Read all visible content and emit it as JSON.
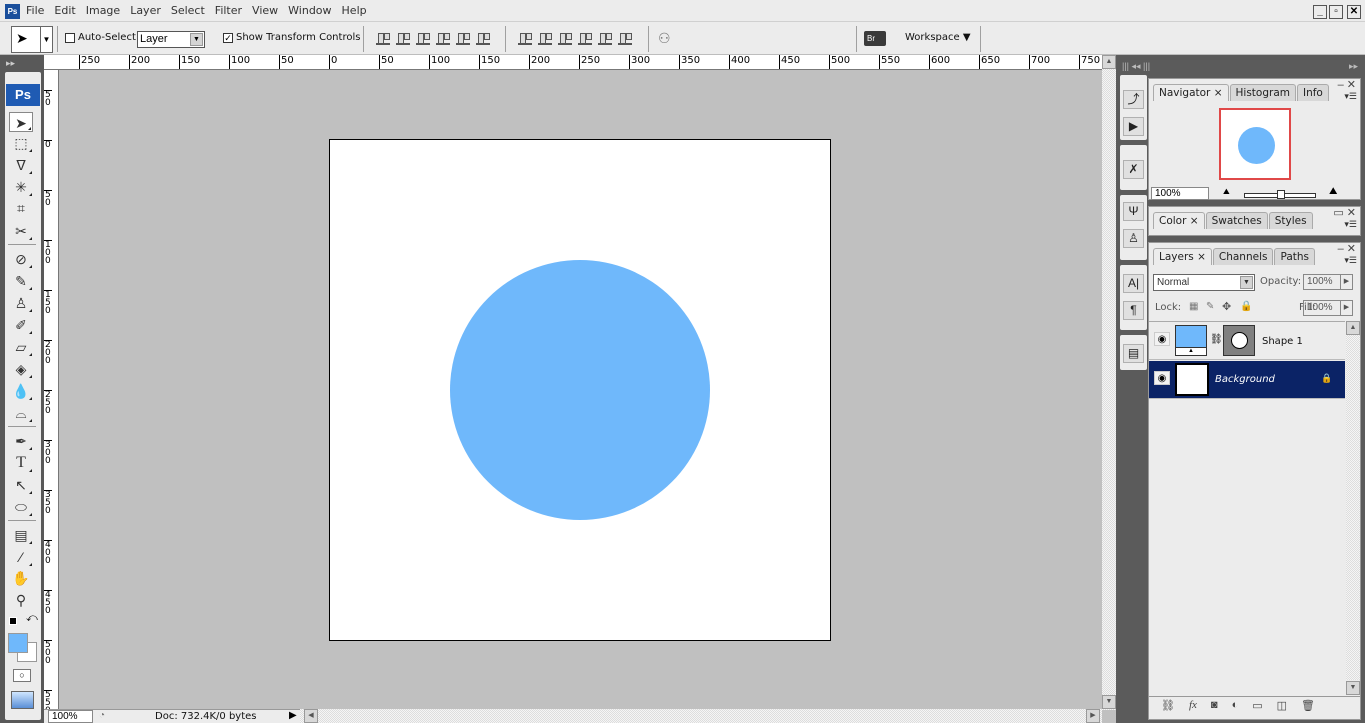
{
  "app": {
    "logo": "Ps",
    "window_controls": {
      "minimize": "_",
      "restore": "▫",
      "close": "✕"
    }
  },
  "menu": [
    "File",
    "Edit",
    "Image",
    "Layer",
    "Select",
    "Filter",
    "View",
    "Window",
    "Help"
  ],
  "options_bar": {
    "auto_select_label": "Auto-Select:",
    "auto_select_checked": false,
    "auto_select_target": "Layer",
    "show_transform_label": "Show Transform Controls",
    "show_transform_checked": true,
    "workspace_label": "Workspace ▼",
    "bridge_icon": "Br"
  },
  "toolbox": {
    "logo": "Ps",
    "tools": [
      "move",
      "marquee",
      "lasso",
      "magic-wand",
      "crop",
      "slice",
      "healing-brush",
      "brush",
      "clone-stamp",
      "history-brush",
      "eraser",
      "paint-bucket",
      "blur",
      "dodge",
      "pen",
      "type",
      "path-selection",
      "ellipse",
      "notes",
      "eyedropper",
      "hand",
      "zoom"
    ],
    "foreground_color": "#6fb8fb",
    "background_color": "#ffffff"
  },
  "rulers": {
    "top": [
      "250",
      "200",
      "150",
      "100",
      "50",
      "0",
      "50",
      "100",
      "150",
      "200",
      "250",
      "300",
      "350",
      "400",
      "450",
      "500",
      "550",
      "600",
      "650",
      "700",
      "750"
    ],
    "left": [
      "50",
      "0",
      "50",
      "100",
      "150",
      "200",
      "250",
      "300",
      "350",
      "400",
      "450",
      "500",
      "550"
    ]
  },
  "document": {
    "shape_color": "#6fb8fb",
    "canvas_color": "#ffffff"
  },
  "status": {
    "zoom": "100%",
    "doc_info": "Doc: 732.4K/0 bytes"
  },
  "panels": {
    "navigator": {
      "tabs": [
        "Navigator ×",
        "Histogram",
        "Info"
      ],
      "zoom_value": "100%",
      "zoom_slider_fraction": 0.5
    },
    "color": {
      "tabs": [
        "Color ×",
        "Swatches",
        "Styles"
      ]
    },
    "layers": {
      "tabs": [
        "Layers ×",
        "Channels",
        "Paths"
      ],
      "blend_mode": "Normal",
      "opacity_label": "Opacity:",
      "opacity": "100%",
      "lock_label": "Lock:",
      "fill_label": "Fill:",
      "fill": "100%",
      "layers": [
        {
          "name": "Shape 1",
          "visible": true,
          "selected": false
        },
        {
          "name": "Background",
          "visible": true,
          "selected": true,
          "locked": true
        }
      ]
    }
  }
}
